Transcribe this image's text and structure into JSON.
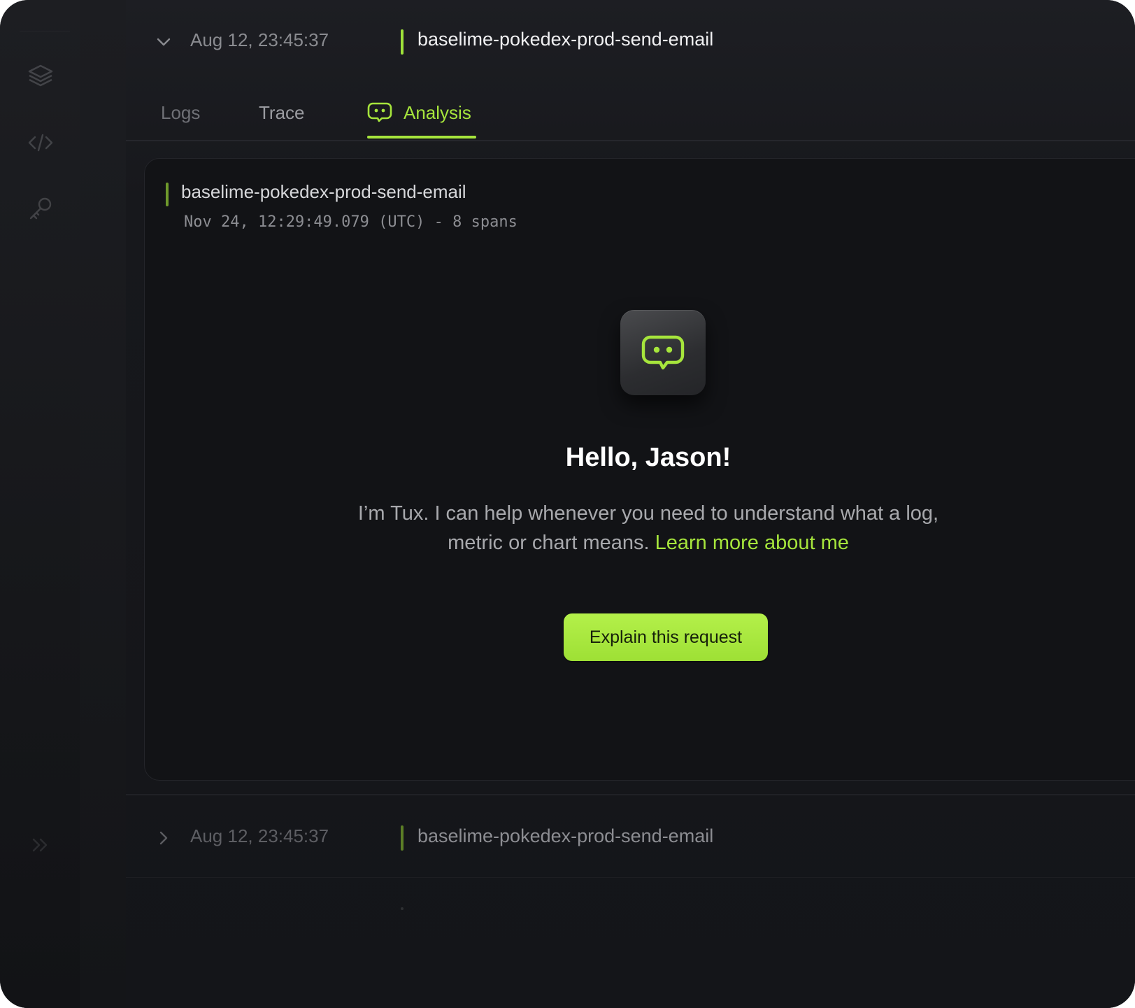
{
  "sidebar": {
    "icons": [
      "layers-icon",
      "code-icon",
      "key-icon",
      "expand-icon"
    ]
  },
  "top_row": {
    "time": "Aug 12, 23:45:37",
    "name": "baselime-pokedex-prod-send-email"
  },
  "tabs": [
    {
      "label": "Logs"
    },
    {
      "label": "Trace"
    },
    {
      "label": "Analysis",
      "active": true
    }
  ],
  "panel": {
    "title": "baselime-pokedex-prod-send-email",
    "meta": "Nov 24, 12:29:49.079 (UTC) - 8 spans",
    "greeting": "Hello, Jason!",
    "intro_text": "I’m Tux. I can help whenever you need to understand what a log, metric or chart means.",
    "learn_more": "Learn more about me",
    "cta_label": "Explain this request"
  },
  "bottom_row": {
    "time": "Aug 12, 23:45:37",
    "name": "baselime-pokedex-prod-send-email"
  },
  "colors": {
    "accent": "#a6e53c",
    "background": "#17181c",
    "panel": "#121316"
  }
}
